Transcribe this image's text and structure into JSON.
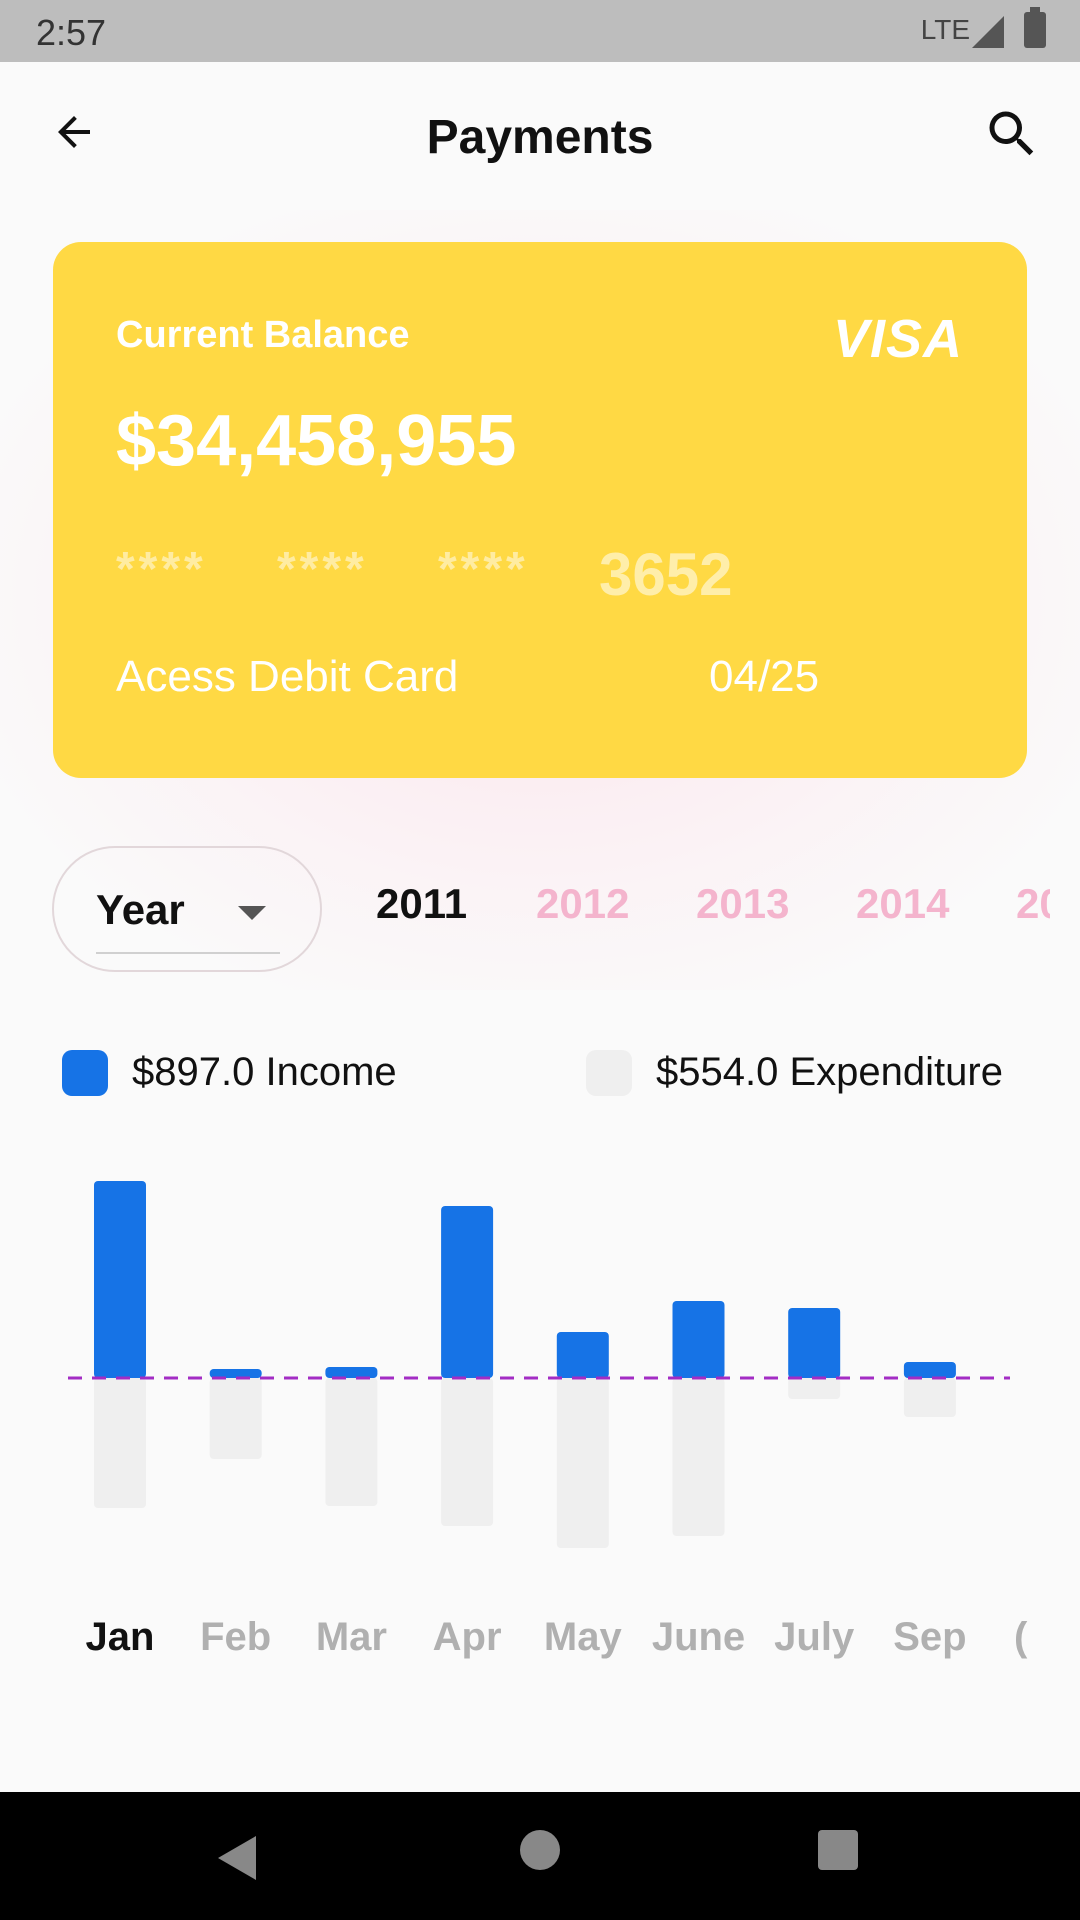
{
  "status": {
    "time": "2:57",
    "network": "LTE"
  },
  "header": {
    "title": "Payments"
  },
  "card": {
    "label": "Current Balance",
    "balance": "$34,458,955",
    "brand": "VISA",
    "masked": [
      "****",
      "****",
      "****"
    ],
    "last4": "3652",
    "name": "Acess Debit Card",
    "expiry": "04/25",
    "color": "#ffd944"
  },
  "filter": {
    "selected": "Year",
    "years": [
      "2011",
      "2012",
      "2013",
      "2014",
      "20"
    ],
    "active_year": "2011"
  },
  "legend": {
    "income": "$897.0 Income",
    "expenditure": "$554.0 Expenditure",
    "income_color": "#1673e6",
    "expenditure_color": "#efefef"
  },
  "chart_data": {
    "type": "bar",
    "categories": [
      "Jan",
      "Feb",
      "Mar",
      "Apr",
      "May",
      "June",
      "July",
      "Sep"
    ],
    "series": [
      {
        "name": "Income",
        "values": [
          197,
          9,
          11,
          172,
          46,
          77,
          70,
          16
        ]
      },
      {
        "name": "Expenditure",
        "values": [
          130,
          81,
          128,
          148,
          170,
          158,
          21,
          39
        ]
      }
    ],
    "reference_line": 0,
    "active_category": "Jan"
  },
  "months": [
    "Jan",
    "Feb",
    "Mar",
    "Apr",
    "May",
    "June",
    "July",
    "Sep",
    "("
  ]
}
